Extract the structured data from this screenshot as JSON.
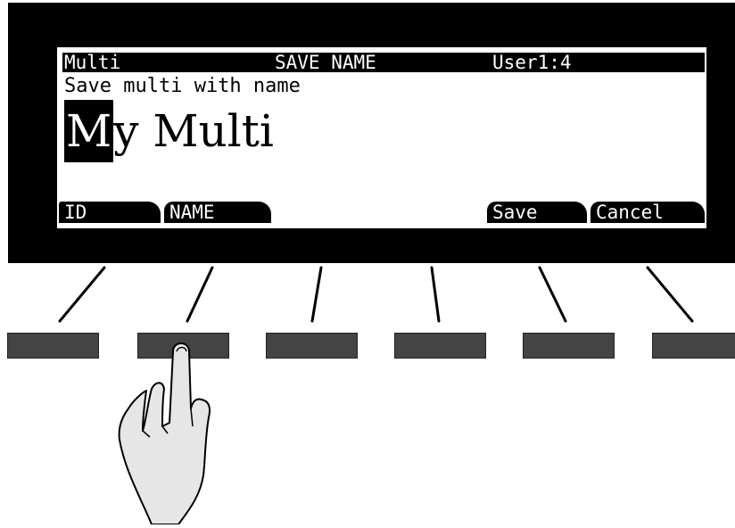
{
  "lcd": {
    "header": {
      "mode": "Multi",
      "title": "SAVE NAME",
      "bank": "User1:4"
    },
    "prompt": "Save multi with name",
    "name": {
      "cursor_char": "M",
      "rest": "y Multi"
    },
    "softkeys": [
      "ID",
      "NAME",
      "",
      "",
      "Save",
      "Cancel"
    ]
  },
  "colors": {
    "bezel": "#000000",
    "lcd_bg": "#ffffff",
    "button": "#444444",
    "hand_fill": "#e6e6e6"
  },
  "icons": {
    "pointer": "pointing-hand-icon"
  }
}
